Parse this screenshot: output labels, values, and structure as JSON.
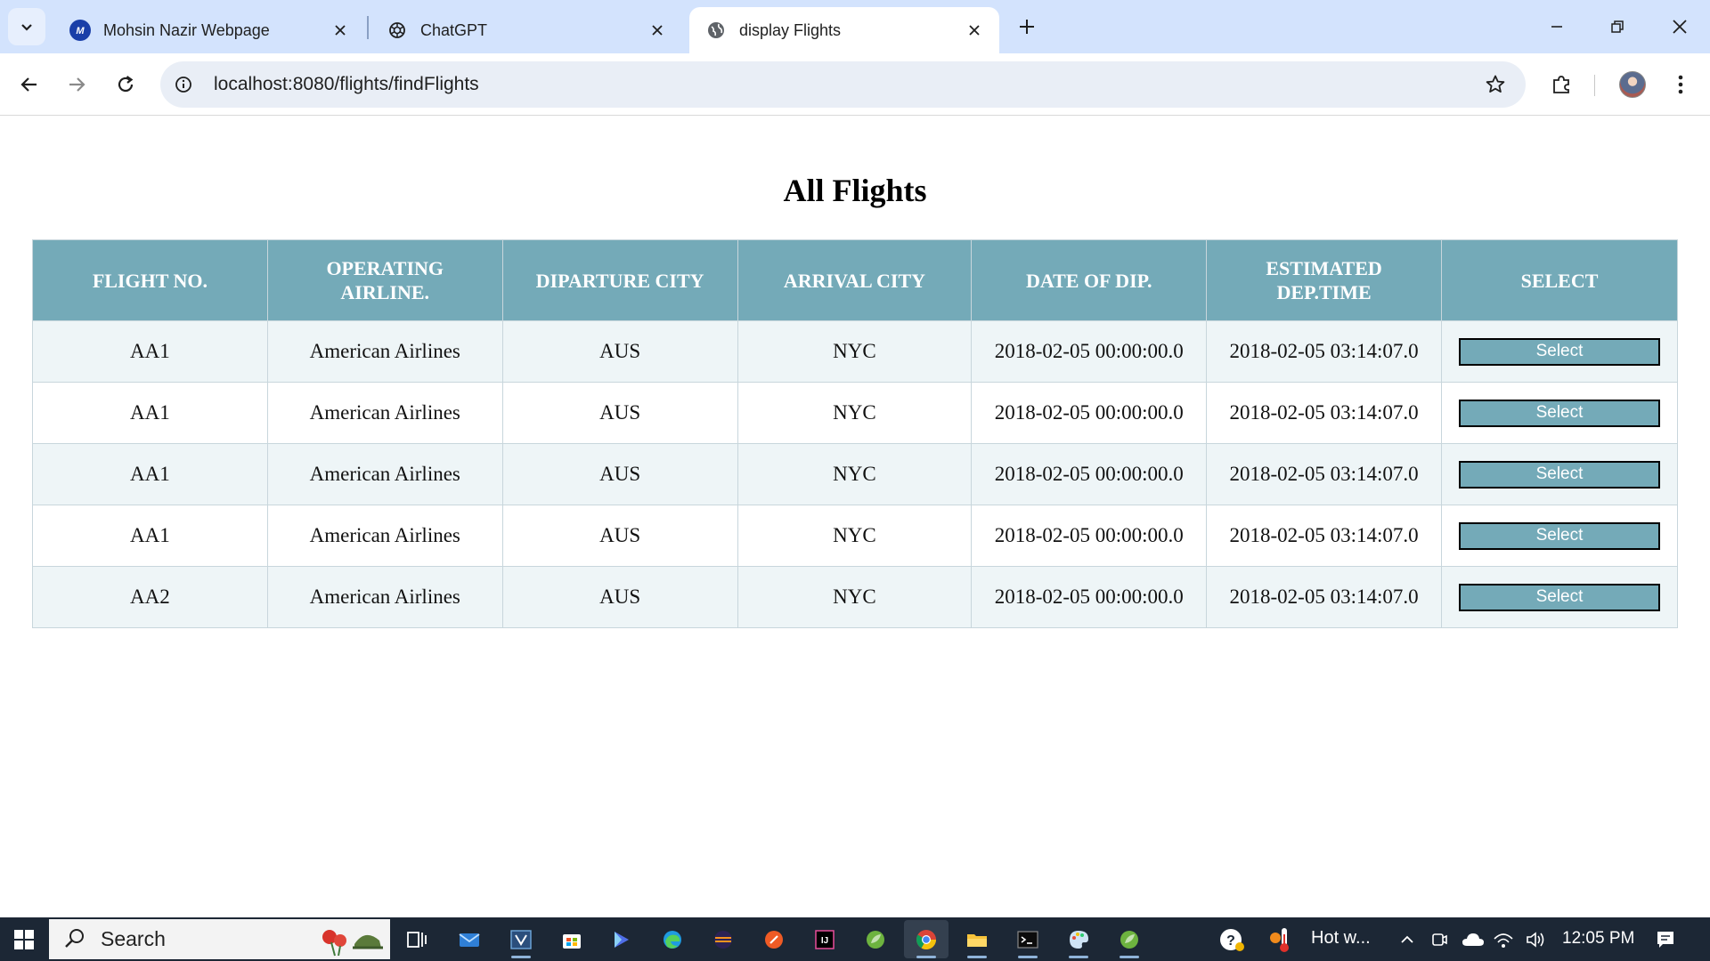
{
  "browser": {
    "tabs": [
      {
        "title": "Mohsin Nazir Webpage",
        "active": false
      },
      {
        "title": "ChatGPT",
        "active": false
      },
      {
        "title": "display Flights",
        "active": true
      }
    ],
    "url": "localhost:8080/flights/findFlights"
  },
  "page": {
    "title": "All Flights",
    "table": {
      "headers": [
        "FLIGHT NO.",
        "OPERATING AIRLINE.",
        "DIPARTURE CITY",
        "ARRIVAL CITY",
        "DATE OF DIP.",
        "ESTIMATED DEP.TIME",
        "SELECT"
      ],
      "rows": [
        {
          "flight_no": "AA1",
          "airline": "American Airlines",
          "departure_city": "AUS",
          "arrival_city": "NYC",
          "date": "2018-02-05 00:00:00.0",
          "est_time": "2018-02-05 03:14:07.0",
          "action": "Select"
        },
        {
          "flight_no": "AA1",
          "airline": "American Airlines",
          "departure_city": "AUS",
          "arrival_city": "NYC",
          "date": "2018-02-05 00:00:00.0",
          "est_time": "2018-02-05 03:14:07.0",
          "action": "Select"
        },
        {
          "flight_no": "AA1",
          "airline": "American Airlines",
          "departure_city": "AUS",
          "arrival_city": "NYC",
          "date": "2018-02-05 00:00:00.0",
          "est_time": "2018-02-05 03:14:07.0",
          "action": "Select"
        },
        {
          "flight_no": "AA1",
          "airline": "American Airlines",
          "departure_city": "AUS",
          "arrival_city": "NYC",
          "date": "2018-02-05 00:00:00.0",
          "est_time": "2018-02-05 03:14:07.0",
          "action": "Select"
        },
        {
          "flight_no": "AA2",
          "airline": "American Airlines",
          "departure_city": "AUS",
          "arrival_city": "NYC",
          "date": "2018-02-05 00:00:00.0",
          "est_time": "2018-02-05 03:14:07.0",
          "action": "Select"
        }
      ]
    }
  },
  "taskbar": {
    "search_label": "Search",
    "weather_text": "Hot w...",
    "time": "12:05 PM"
  },
  "colors": {
    "header_bg": "#74aab8",
    "odd_row_bg": "#eef5f7",
    "tab_strip_bg": "#d3e3fd",
    "taskbar_bg": "#1c2735"
  }
}
